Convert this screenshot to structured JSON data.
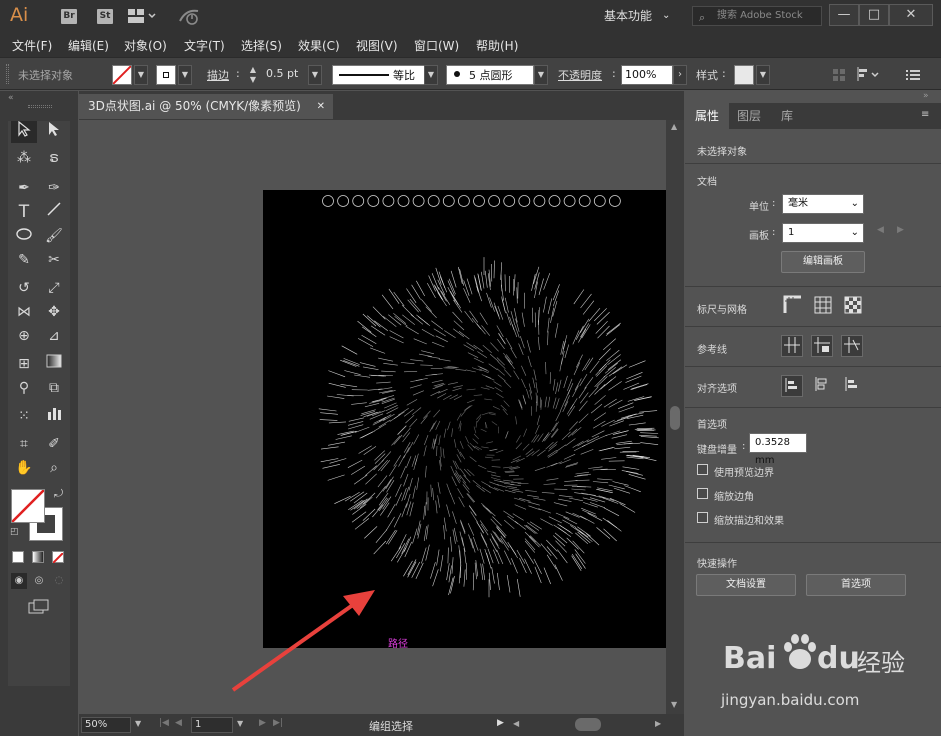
{
  "app": {
    "logo": "Ai",
    "bridge_badge": "Br",
    "stock_badge": "St",
    "workspace": "基本功能",
    "search_placeholder": "搜索 Adobe Stock",
    "minimize": "—",
    "maximize": "□",
    "close": "✕"
  },
  "menu": {
    "items": [
      "文件(F)",
      "编辑(E)",
      "对象(O)",
      "文字(T)",
      "选择(S)",
      "效果(C)",
      "视图(V)",
      "窗口(W)",
      "帮助(H)"
    ]
  },
  "control": {
    "selection_status": "未选择对象",
    "stroke_label": "描边",
    "stroke_weight": "0.5 pt",
    "stroke_profile": "等比",
    "brush": "5 点圆形",
    "opacity_label": "不透明度",
    "opacity_value": "100%",
    "style_label": "样式"
  },
  "document": {
    "tab_title": "3D点状图.ai @ 50% (CMYK/像素预览)",
    "tab_close": "✕",
    "artboard_caption": "路径",
    "circle_count": 20
  },
  "status": {
    "zoom": "50%",
    "artboard_index": "1",
    "status_text": "编组选择"
  },
  "properties": {
    "tabs": [
      "属性",
      "图层",
      "库"
    ],
    "active_tab": "属性",
    "no_selection": "未选择对象",
    "doc_section": "文档",
    "unit_label": "单位",
    "unit_value": "毫米",
    "artboard_label": "画板",
    "artboard_value": "1",
    "edit_artboard_btn": "编辑画板",
    "ruler_section": "标尺与网格",
    "guides_section": "参考线",
    "align_section": "对齐选项",
    "prefs_section": "首选项",
    "keyboard_increment_label": "键盘增量",
    "keyboard_increment_value": "0.3528 mm",
    "use_preview_bounds": "使用预览边界",
    "scale_corners": "缩放边角",
    "scale_strokes": "缩放描边和效果",
    "quick_actions_section": "快速操作",
    "doc_setup_btn": "文档设置",
    "prefs_btn": "首选项"
  },
  "watermark": {
    "logo_text": "Bai",
    "logo_text2": "du",
    "logo_cn": "经验",
    "url": "jingyan.baidu.com"
  },
  "colors": {
    "artboard": "#000000",
    "arrow": "#e8413c",
    "caption": "#e040e0",
    "accent": "#d98f4a"
  }
}
